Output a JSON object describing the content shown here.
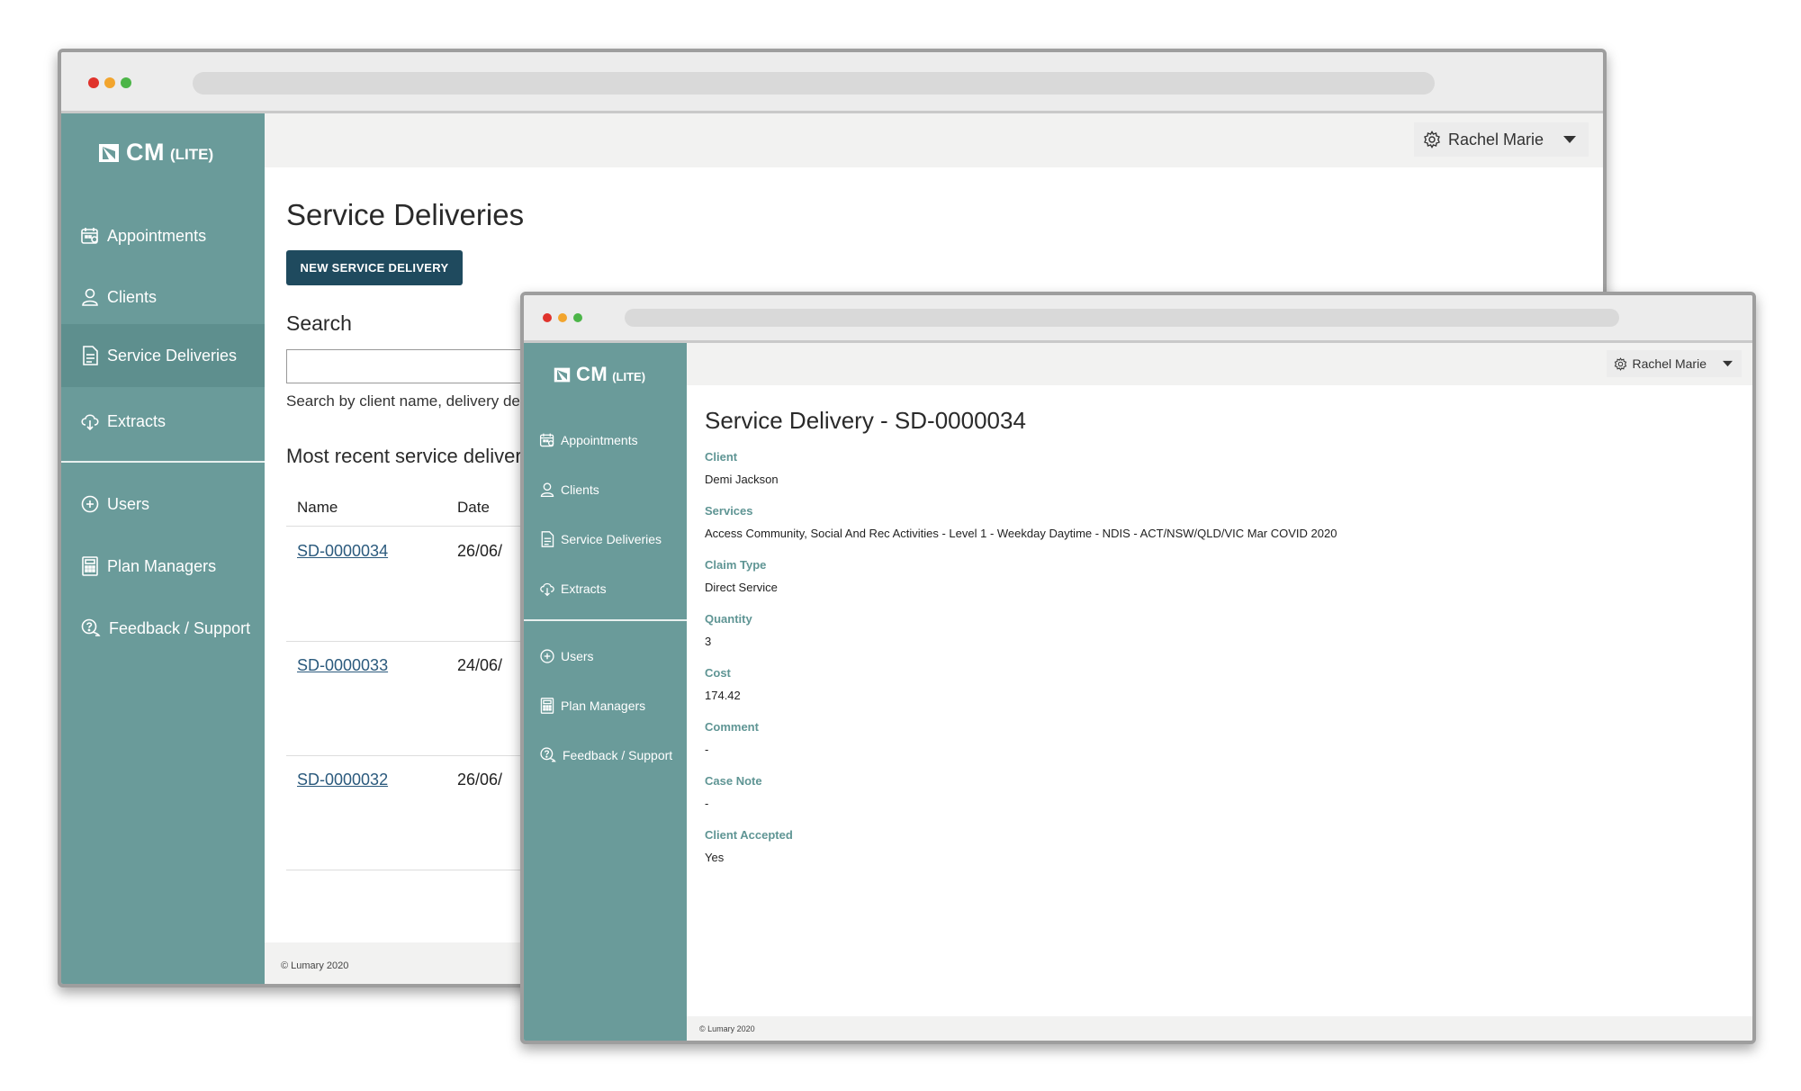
{
  "app": {
    "logo_brand": "CM",
    "logo_edition": "(LITE)",
    "user_name": "Rachel Marie",
    "footer": "© Lumary 2020"
  },
  "sidebar": {
    "items": [
      {
        "label": "Appointments",
        "icon": "calendar-icon"
      },
      {
        "label": "Clients",
        "icon": "user-icon"
      },
      {
        "label": "Service Deliveries",
        "icon": "document-icon"
      },
      {
        "label": "Extracts",
        "icon": "cloud-download-icon"
      }
    ],
    "items2": [
      {
        "label": "Users",
        "icon": "plus-circle-icon"
      },
      {
        "label": "Plan Managers",
        "icon": "calculator-icon"
      },
      {
        "label": "Feedback / Support",
        "icon": "help-chat-icon"
      }
    ]
  },
  "back_window": {
    "page_title": "Service Deliveries",
    "new_button": "NEW SERVICE DELIVERY",
    "search_label": "Search",
    "search_value": "",
    "search_hint": "Search by client name, delivery de",
    "recent_heading": "Most recent service deliveri",
    "columns": [
      "Name",
      "Date"
    ],
    "rows": [
      {
        "name": "SD-0000034",
        "date": "26/06/"
      },
      {
        "name": "SD-0000033",
        "date": "24/06/"
      },
      {
        "name": "SD-0000032",
        "date": "26/06/"
      }
    ]
  },
  "front_window": {
    "page_title": "Service Delivery - SD-0000034",
    "fields": [
      {
        "label": "Client",
        "value": "Demi Jackson"
      },
      {
        "label": "Services",
        "value": "Access Community, Social And Rec Activities - Level 1 - Weekday Daytime - NDIS - ACT/NSW/QLD/VIC Mar COVID 2020"
      },
      {
        "label": "Claim Type",
        "value": "Direct Service"
      },
      {
        "label": "Quantity",
        "value": "3"
      },
      {
        "label": "Cost",
        "value": "174.42"
      },
      {
        "label": "Comment",
        "value": "-"
      },
      {
        "label": "Case Note",
        "value": "-"
      },
      {
        "label": "Client Accepted",
        "value": "Yes"
      }
    ]
  },
  "colors": {
    "sidebar": "#6a9b9a",
    "sidebar_active": "#5e8f8e",
    "button": "#1f4a5e",
    "link": "#2b5a7d",
    "field_label": "#5f9594",
    "dot_red": "#e0332c",
    "dot_yellow": "#f2a52e",
    "dot_green": "#4cb548"
  }
}
